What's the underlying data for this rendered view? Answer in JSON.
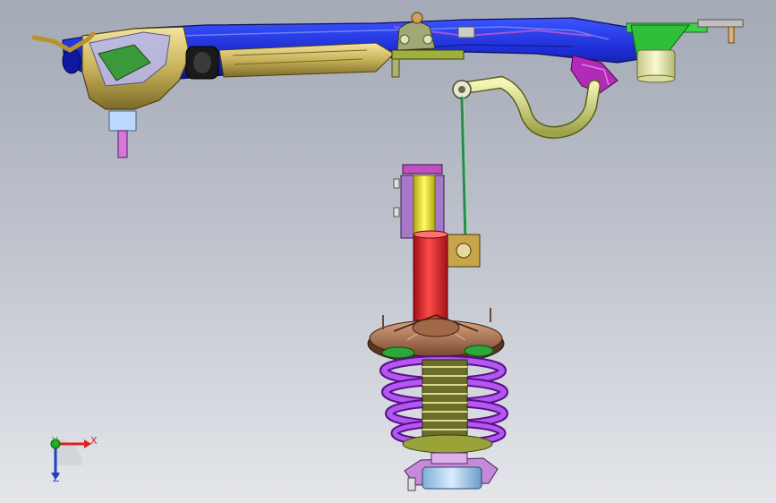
{
  "viewport": {
    "background_top": "#a3a9b5",
    "background_bottom": "#e4e6ea"
  },
  "assembly": {
    "parts": [
      {
        "name": "subframe",
        "color": "#1f2fd6"
      },
      {
        "name": "lower-control-arm",
        "color": "#c8b25a"
      },
      {
        "name": "ball-joint",
        "color": "#9fb13c"
      },
      {
        "name": "stabilizer-bar",
        "color": "#d9de8a"
      },
      {
        "name": "stabilizer-link",
        "color": "#3dbb6a"
      },
      {
        "name": "strut-piston-rod",
        "color": "#f2ea2a"
      },
      {
        "name": "strut-damper-tube",
        "color": "#e5262a"
      },
      {
        "name": "coil-spring",
        "color": "#9b2fe0"
      },
      {
        "name": "spring-seat",
        "color": "#b07a5a"
      },
      {
        "name": "dust-boot",
        "color": "#8a8f3a"
      },
      {
        "name": "knuckle-bracket",
        "color": "#8fc7e8"
      }
    ]
  },
  "triad": {
    "x_label": "X",
    "y_label": "Y",
    "z_label": "Z",
    "x_color": "#e02020",
    "y_color": "#20b020",
    "z_color": "#2040c0"
  }
}
